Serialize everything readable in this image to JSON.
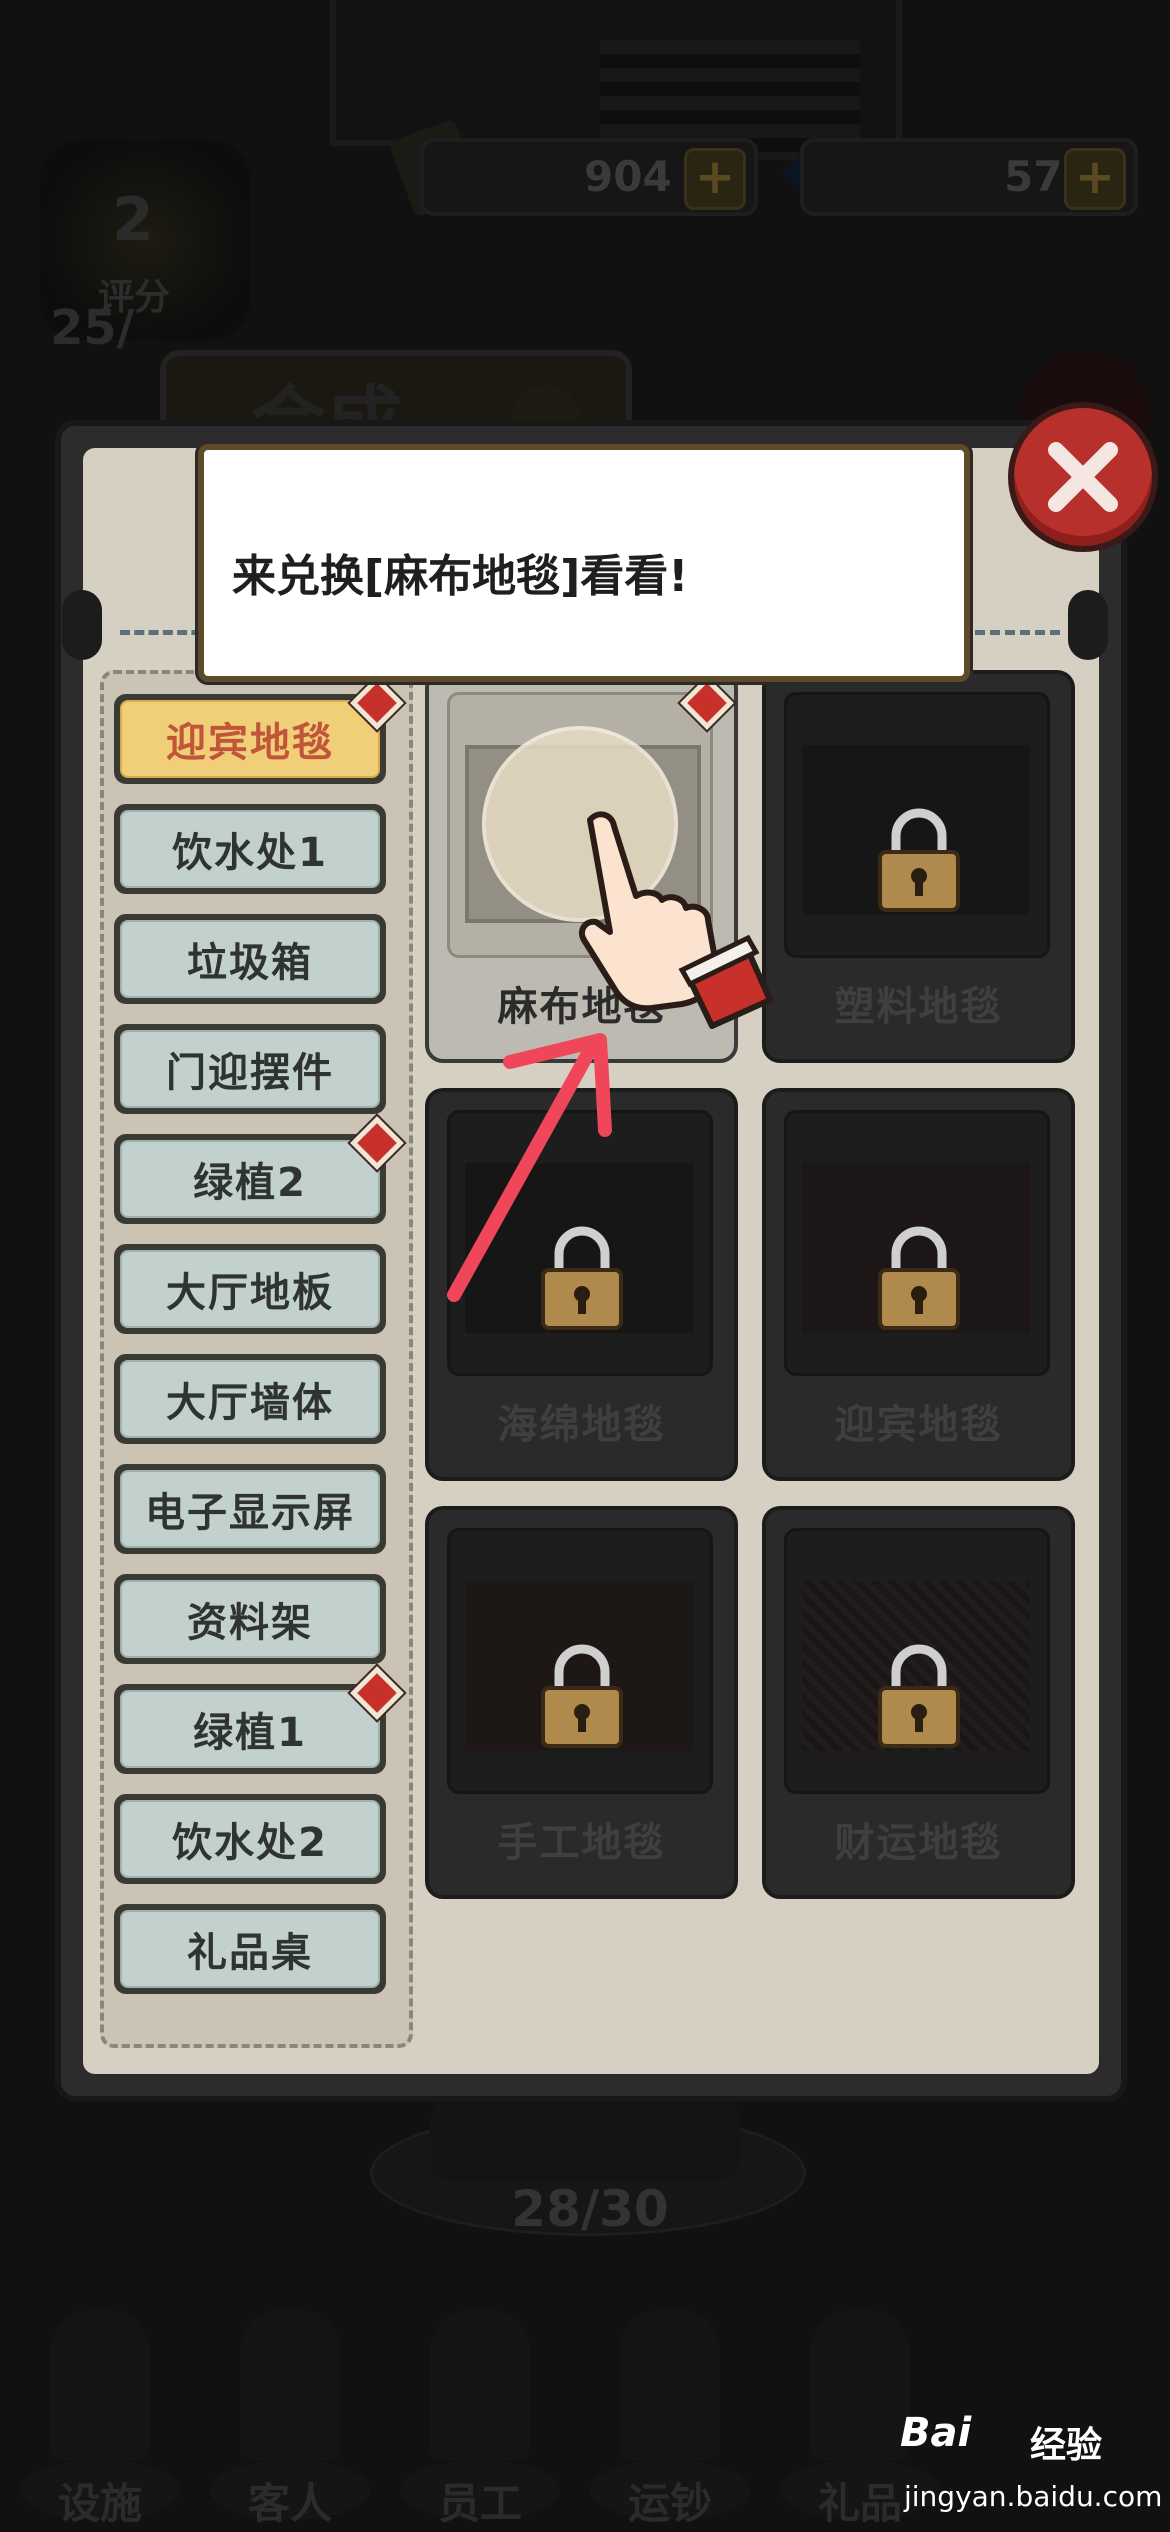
{
  "hud": {
    "rating_level": "2",
    "rating_label": "评分",
    "rating_value": "25/",
    "coins": "904",
    "gems": "57",
    "plus": "+"
  },
  "background_dialog": {
    "title": "合成"
  },
  "tooltip": {
    "text": "来兑换[麻布地毯]看看!"
  },
  "categories": [
    {
      "label": "迎宾地毯",
      "active": true,
      "badge": true
    },
    {
      "label": "饮水处1",
      "active": false,
      "badge": false
    },
    {
      "label": "垃圾箱",
      "active": false,
      "badge": false
    },
    {
      "label": "门迎摆件",
      "active": false,
      "badge": false
    },
    {
      "label": "绿植2",
      "active": false,
      "badge": true
    },
    {
      "label": "大厅地板",
      "active": false,
      "badge": false
    },
    {
      "label": "大厅墙体",
      "active": false,
      "badge": false
    },
    {
      "label": "电子显示屏",
      "active": false,
      "badge": false
    },
    {
      "label": "资料架",
      "active": false,
      "badge": false
    },
    {
      "label": "绿植1",
      "active": false,
      "badge": true
    },
    {
      "label": "饮水处2",
      "active": false,
      "badge": false
    },
    {
      "label": "礼品桌",
      "active": false,
      "badge": false
    }
  ],
  "items": [
    {
      "label": "麻布地毯",
      "locked": false,
      "badge": true
    },
    {
      "label": "塑料地毯",
      "locked": true,
      "badge": false
    },
    {
      "label": "海绵地毯",
      "locked": true,
      "badge": false
    },
    {
      "label": "迎宾地毯",
      "locked": true,
      "badge": false
    },
    {
      "label": "手工地毯",
      "locked": true,
      "badge": false
    },
    {
      "label": "财运地毯",
      "locked": true,
      "badge": false
    }
  ],
  "counter": "28/30",
  "bottom_nav": [
    {
      "label": "设施"
    },
    {
      "label": "客人"
    },
    {
      "label": "员工"
    },
    {
      "label": "运钞"
    },
    {
      "label": "礼品"
    }
  ],
  "watermark": {
    "brand": "Bai",
    "brand_cn": "经验",
    "url": "jingyan.baidu.com"
  },
  "colors": {
    "accent_red": "#c7302b",
    "active_tab": "#f0cf78",
    "tooltip_border": "#5f4b2a",
    "arrow": "#f0465a"
  }
}
